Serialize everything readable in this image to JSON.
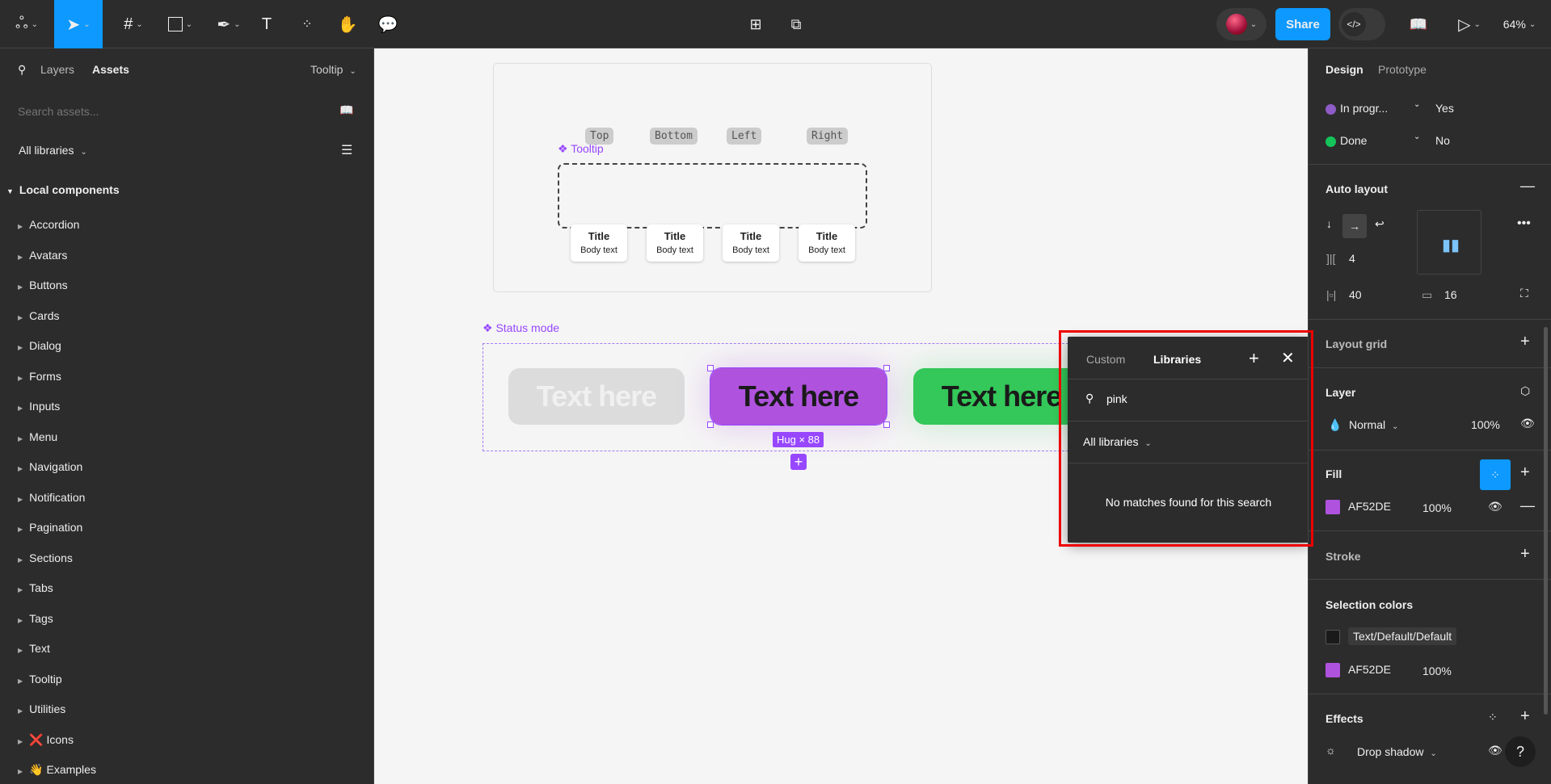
{
  "toolbar": {
    "share_label": "Share",
    "zoom_label": "64%",
    "colors": {
      "accent": "#0d99ff"
    }
  },
  "left_panel": {
    "tab_layers": "Layers",
    "tab_assets": "Assets",
    "page_select": "Tooltip",
    "search_placeholder": "Search assets...",
    "libraries_filter": "All libraries",
    "section_title": "Local components",
    "items": [
      "Accordion",
      "Avatars",
      "Buttons",
      "Cards",
      "Dialog",
      "Forms",
      "Inputs",
      "Menu",
      "Navigation",
      "Notification",
      "Pagination",
      "Sections",
      "Tabs",
      "Tags",
      "Text",
      "Tooltip",
      "Utilities",
      "❌ Icons",
      "👋 Examples"
    ]
  },
  "canvas": {
    "tooltip_frame_label": "Tooltip",
    "placement_tags": [
      "Top",
      "Bottom",
      "Left",
      "Right"
    ],
    "tooltip_title": "Title",
    "tooltip_body": "Body text",
    "status_label": "Status mode",
    "button_text": "Text here",
    "size_badge": "Hug × 88",
    "colors": {
      "purple": "#af52de",
      "green": "#34c759",
      "gray": "#dcdcdc"
    }
  },
  "popup": {
    "tab_custom": "Custom",
    "tab_libraries": "Libraries",
    "search_value": "pink",
    "filter": "All libraries",
    "empty_message": "No matches found for this search"
  },
  "right_panel": {
    "tab_design": "Design",
    "tab_prototype": "Prototype",
    "variants": [
      {
        "name": "In progr...",
        "value": "Yes",
        "color": "#8e5cc6"
      },
      {
        "name": "Done",
        "value": "No",
        "color": "#14c45a"
      }
    ],
    "auto_layout": {
      "title": "Auto layout",
      "gap": "4",
      "h_padding": "40",
      "v_padding": "16"
    },
    "layout_grid": "Layout grid",
    "layer": {
      "title": "Layer",
      "blend": "Normal",
      "opacity": "100%"
    },
    "fill": {
      "title": "Fill",
      "hex": "AF52DE",
      "opacity": "100%"
    },
    "stroke": "Stroke",
    "selection_colors": {
      "title": "Selection colors",
      "style": "Text/Default/Default",
      "hex": "AF52DE",
      "opacity": "100%"
    },
    "effects": {
      "title": "Effects",
      "effect": "Drop shadow"
    }
  }
}
